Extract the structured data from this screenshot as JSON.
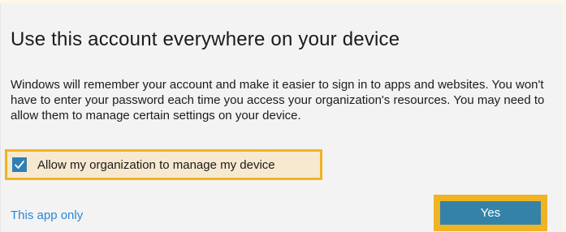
{
  "dialog": {
    "title": "Use this account everywhere on your device",
    "body": "Windows will remember your account and make it easier to sign in to apps and websites. You won't have to enter your password each time you access your organization's resources. You may need to allow them to manage certain settings on your device.",
    "checkbox": {
      "label": "Allow my organization to manage my device",
      "checked": true
    },
    "link_label": "This app only",
    "primary_button_label": "Yes"
  },
  "colors": {
    "highlight": "#f0b323",
    "accent": "#3582a9",
    "link": "#2a86d6",
    "checkbox": "#2f7fb8"
  }
}
